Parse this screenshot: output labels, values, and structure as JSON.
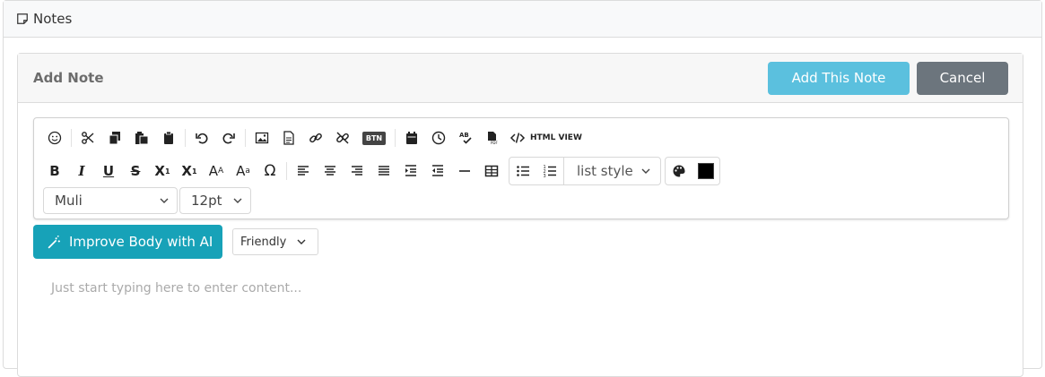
{
  "panel": {
    "title": "Notes"
  },
  "card": {
    "title": "Add Note",
    "add_label": "Add This Note",
    "cancel_label": "Cancel"
  },
  "toolbar": {
    "row1": [
      "emoji-icon",
      "cut-icon",
      "copy-icon",
      "paste-icon",
      "paste-text-icon",
      "undo-icon",
      "redo-icon",
      "image-icon",
      "file-icon",
      "link-icon",
      "unlink-icon",
      "button-icon",
      "calendar-icon",
      "clock-icon",
      "spellcheck-icon",
      "pdf-icon",
      "code-icon"
    ],
    "button_text": "BTN",
    "html_view_label": "HTML VIEW",
    "list_style_label": "list style",
    "font_family": "Muli",
    "font_size": "12pt",
    "text_color": "#000000"
  },
  "ai": {
    "improve_label": "Improve Body with AI",
    "tone_value": "Friendly"
  },
  "content": {
    "placeholder": "Just start typing here to enter content..."
  }
}
